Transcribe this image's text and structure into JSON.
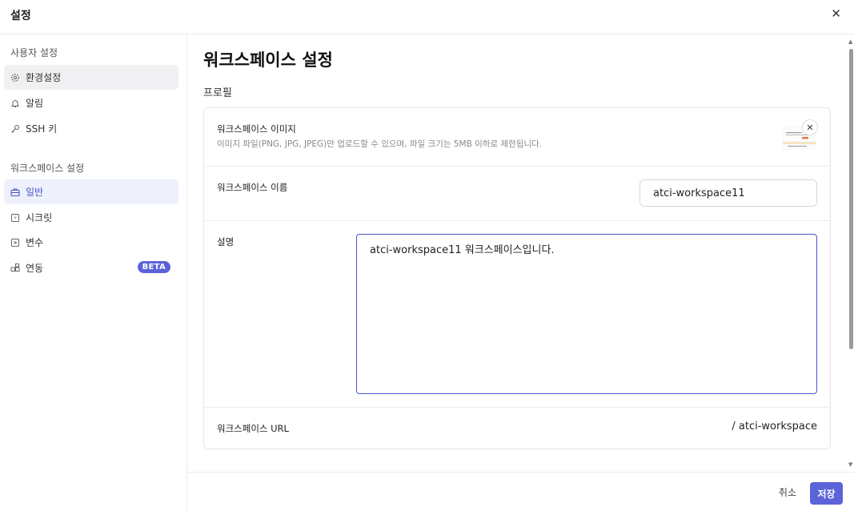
{
  "dialog": {
    "title": "설정"
  },
  "sidebar": {
    "user_section": "사용자 설정",
    "user_items": [
      {
        "label": "환경설정",
        "icon": "gear-icon"
      },
      {
        "label": "알림",
        "icon": "bell-icon"
      },
      {
        "label": "SSH 키",
        "icon": "key-icon"
      }
    ],
    "workspace_section": "워크스페이스 설정",
    "workspace_items": [
      {
        "label": "일반",
        "icon": "briefcase-icon"
      },
      {
        "label": "시크릿",
        "icon": "secret-icon"
      },
      {
        "label": "변수",
        "icon": "variable-icon"
      },
      {
        "label": "연동",
        "icon": "integration-icon",
        "badge": "BETA"
      }
    ]
  },
  "main": {
    "title": "워크스페이스 설정",
    "section": "프로필",
    "image": {
      "label": "워크스페이스 이미지",
      "help": "이미지 파일(PNG, JPG, JPEG)만 업로드할 수 있으며, 파일 크기는 5MB 이하로 제한됩니다."
    },
    "name": {
      "label": "워크스페이스 이름",
      "value": "atci-workspace11"
    },
    "description": {
      "label": "설명",
      "value": "atci-workspace11 워크스페이스입니다."
    },
    "url": {
      "label": "워크스페이스 URL",
      "value": "/ atci-workspace"
    }
  },
  "footer": {
    "cancel": "취소",
    "save": "저장"
  },
  "colors": {
    "accent": "#5b63d8",
    "active_bg": "#eef0fc"
  }
}
